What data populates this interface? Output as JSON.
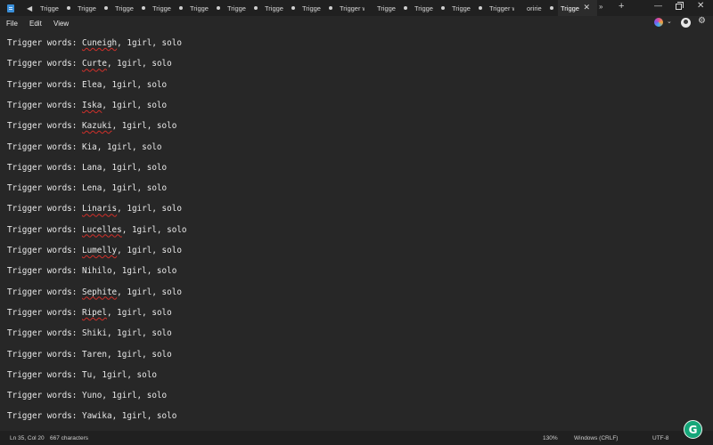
{
  "titlebar": {
    "app_icon": "notepad-icon",
    "scroll_left_glyph": "◀",
    "tabs": [
      {
        "label": "Trigge",
        "modified": true
      },
      {
        "label": "Trigge",
        "modified": true
      },
      {
        "label": "Trigge",
        "modified": true
      },
      {
        "label": "Trigge",
        "modified": true
      },
      {
        "label": "Trigge",
        "modified": true
      },
      {
        "label": "Trigge",
        "modified": true
      },
      {
        "label": "Trigge",
        "modified": true
      },
      {
        "label": "Trigge",
        "modified": true
      },
      {
        "label": "Trigger words",
        "modified": false
      },
      {
        "label": "Trigge",
        "modified": true
      },
      {
        "label": "Trigge",
        "modified": true
      },
      {
        "label": "Trigge",
        "modified": true
      },
      {
        "label": "Trigger words",
        "modified": false
      },
      {
        "label": "oririe",
        "modified": true
      },
      {
        "label": "Trigge",
        "modified": false,
        "active": true
      }
    ],
    "close_glyph": "✕",
    "overflow_glyph": "»",
    "new_tab_glyph": "+",
    "minimize_glyph": "—",
    "window_close_glyph": "✕"
  },
  "menu": {
    "items": [
      "File",
      "Edit",
      "View"
    ],
    "copilot_chevron": "⌄",
    "settings_glyph": "⚙"
  },
  "editor": {
    "prefix": "Trigger words: ",
    "suffix": ", 1girl, solo",
    "names": [
      "Cuneigh",
      "Curte",
      "Elea",
      "Iska",
      "Kazuki",
      "Kia",
      "Lana",
      "Lena",
      "Linaris",
      "Lucelles",
      "Lumelly",
      "Nihilo",
      "Sephite",
      "Ripel",
      "Shiki",
      "Taren",
      "Tu",
      "Yuno",
      "Yawika"
    ],
    "misspelled": [
      "Cuneigh",
      "Curte",
      "Iska",
      "Kazuki",
      "Linaris",
      "Lucelles",
      "Lumelly",
      "Sephite",
      "Ripel"
    ]
  },
  "status": {
    "position": "Ln 35, Col 20",
    "characters": "667 characters",
    "zoom": "130%",
    "line_ending": "Windows (CRLF)",
    "encoding": "UTF-8"
  },
  "grammarly": {
    "letter": "G",
    "color": "#15a679"
  }
}
